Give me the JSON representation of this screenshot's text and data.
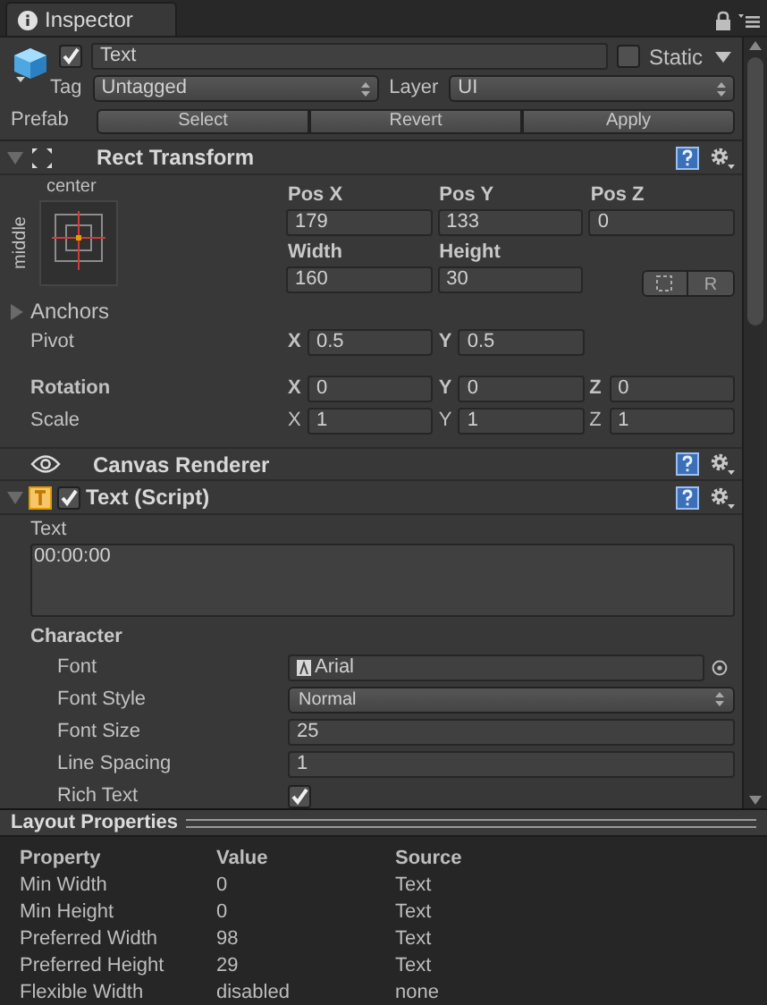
{
  "tab": {
    "title": "Inspector"
  },
  "object": {
    "active": true,
    "name": "Text",
    "static": false,
    "static_label": "Static",
    "tag_label": "Tag",
    "tag": "Untagged",
    "layer_label": "Layer",
    "layer": "UI",
    "prefab_label": "Prefab",
    "prefab_buttons": [
      "Select",
      "Revert",
      "Apply"
    ]
  },
  "rect_transform": {
    "title": "Rect Transform",
    "expanded": true,
    "anchor_h": "center",
    "anchor_v": "middle",
    "grid": [
      {
        "label": "Pos X",
        "value": "179"
      },
      {
        "label": "Pos Y",
        "value": "133"
      },
      {
        "label": "Pos Z",
        "value": "0"
      },
      {
        "label": "Width",
        "value": "160"
      },
      {
        "label": "Height",
        "value": "30"
      }
    ],
    "raw_button": "R",
    "anchors_label": "Anchors",
    "anchors_expanded": false,
    "vector_rows": [
      {
        "label": "Pivot",
        "bold": false,
        "axis_bold": true,
        "fields": [
          {
            "axis": "X",
            "value": "0.5"
          },
          {
            "axis": "Y",
            "value": "0.5"
          }
        ]
      },
      {
        "label": "Rotation",
        "bold": true,
        "axis_bold": true,
        "fields": [
          {
            "axis": "X",
            "value": "0"
          },
          {
            "axis": "Y",
            "value": "0"
          },
          {
            "axis": "Z",
            "value": "0"
          }
        ]
      },
      {
        "label": "Scale",
        "bold": false,
        "axis_bold": false,
        "fields": [
          {
            "axis": "X",
            "value": "1"
          },
          {
            "axis": "Y",
            "value": "1"
          },
          {
            "axis": "Z",
            "value": "1"
          }
        ]
      }
    ]
  },
  "canvas_renderer": {
    "title": "Canvas Renderer"
  },
  "text_script": {
    "title": "Text (Script)",
    "enabled": true,
    "expanded": true,
    "text_label": "Text",
    "text_value": "00:00:00",
    "section": "Character",
    "props": [
      {
        "kind": "object",
        "label": "Font",
        "value": "Arial"
      },
      {
        "kind": "dropdown",
        "label": "Font Style",
        "value": "Normal"
      },
      {
        "kind": "number",
        "label": "Font Size",
        "value": "25"
      },
      {
        "kind": "number",
        "label": "Line Spacing",
        "value": "1"
      },
      {
        "kind": "checkbox",
        "label": "Rich Text",
        "checked": true
      }
    ]
  },
  "layout_properties": {
    "title": "Layout Properties",
    "columns": [
      "Property",
      "Value",
      "Source"
    ],
    "rows": [
      [
        "Min Width",
        "0",
        "Text"
      ],
      [
        "Min Height",
        "0",
        "Text"
      ],
      [
        "Preferred Width",
        "98",
        "Text"
      ],
      [
        "Preferred Height",
        "29",
        "Text"
      ],
      [
        "Flexible Width",
        "disabled",
        "none"
      ]
    ]
  }
}
